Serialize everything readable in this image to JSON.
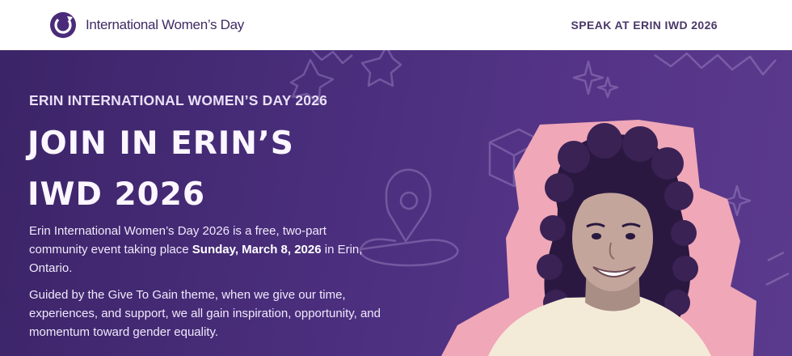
{
  "nav": {
    "logo_text": "International Women’s Day",
    "logo_icon": "iwd-logo-icon",
    "cta": "SPEAK AT ERIN IWD 2026"
  },
  "hero": {
    "eyebrow": "ERIN INTERNATIONAL WOMEN’S DAY 2026",
    "headline_line1": "JOIN IN ERIN’S",
    "headline_line2": "IWD 2026",
    "paragraph1": {
      "before": "Erin International Women’s Day 2026 is a free, two-part community event taking place ",
      "bold": "Sunday, March 8, 2026",
      "after": " in Erin, Ontario."
    },
    "paragraph2": "Guided by the Give To Gain theme, when we give our time, experiences, and support, we all gain inspiration, opportunity, and momentum toward gender equality.",
    "image": "smiling-woman-portrait",
    "colors": {
      "background": "#4b2f7e",
      "accent_pink": "#f0a7b8",
      "text_light": "#f1e9fb",
      "nav_text": "#3f2a63"
    }
  }
}
